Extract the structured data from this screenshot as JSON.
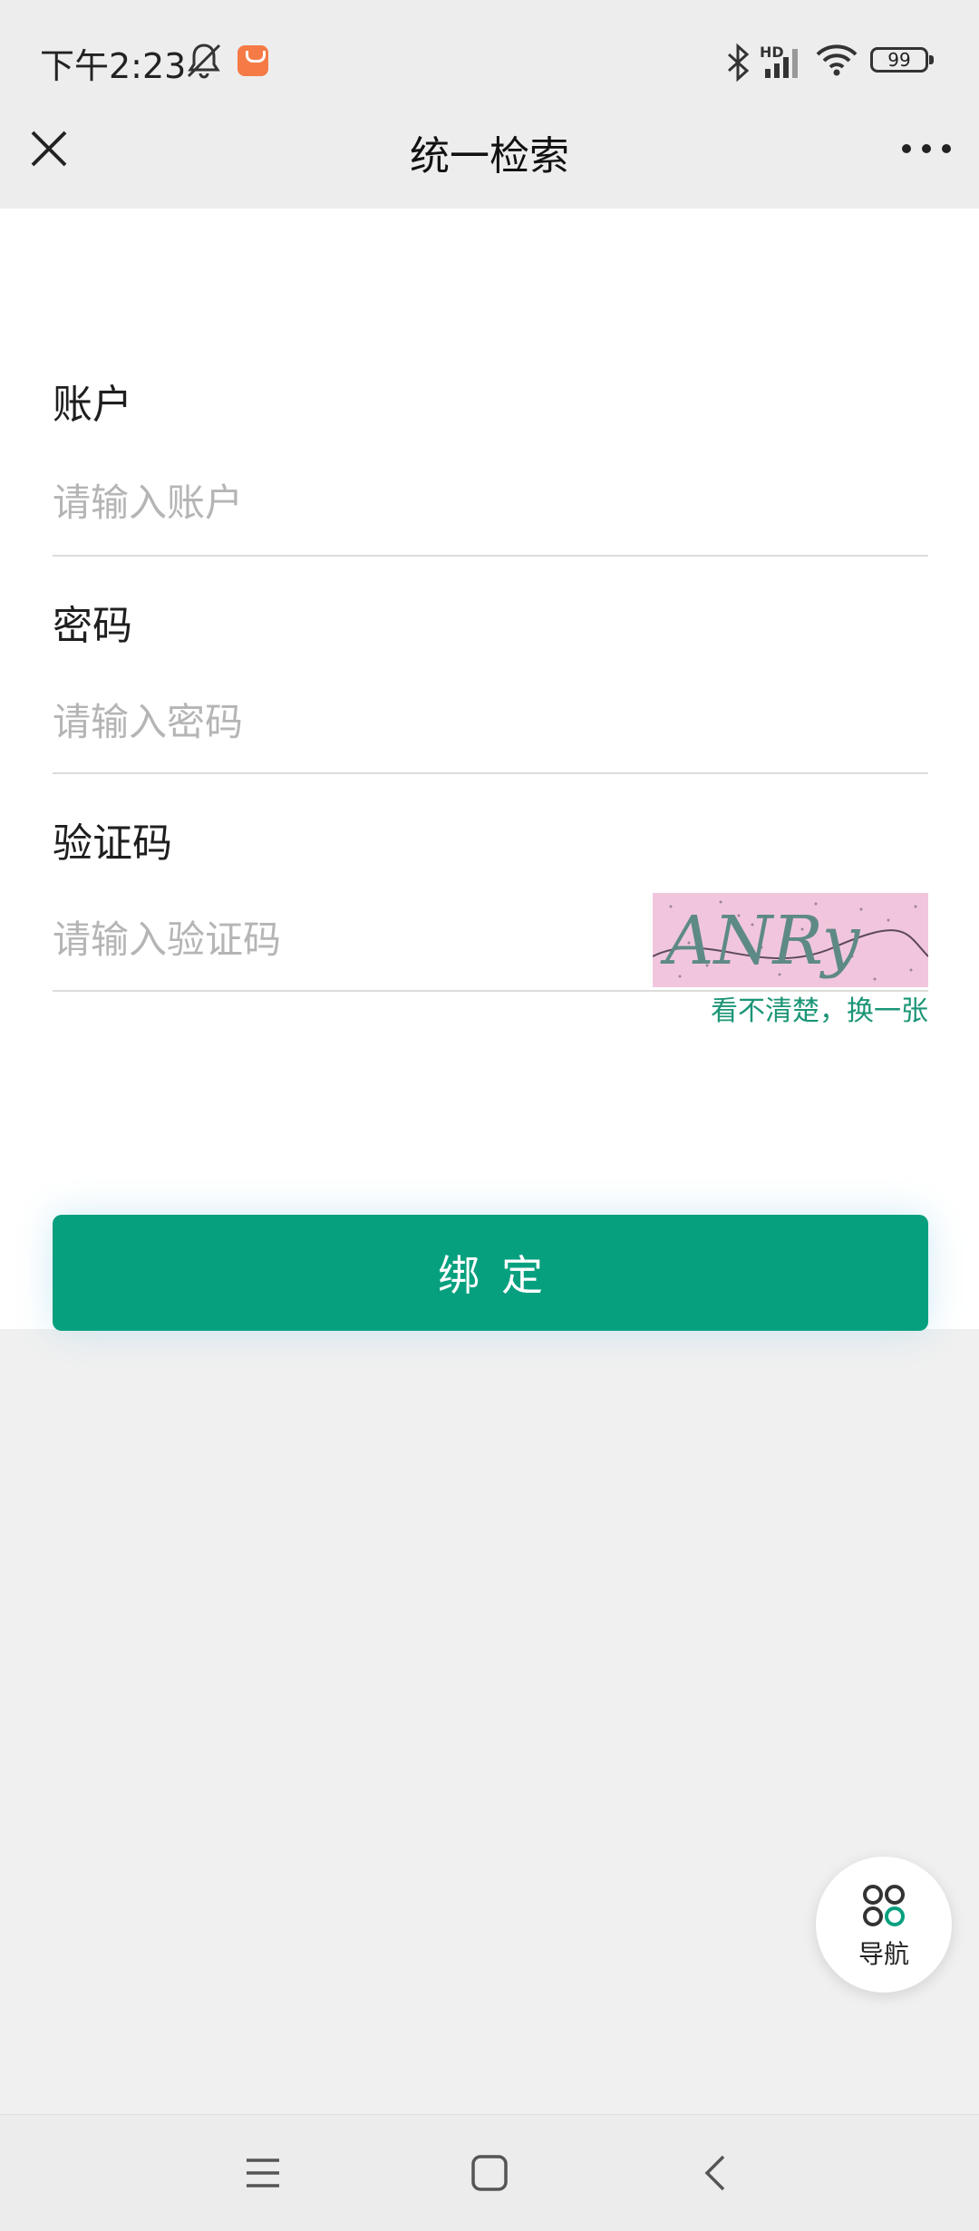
{
  "status_bar": {
    "time": "下午2:23",
    "network": "HD",
    "battery": "99"
  },
  "header": {
    "title": "统一检索",
    "close_icon": "close-icon",
    "more_icon": "more-icon"
  },
  "form": {
    "account": {
      "label": "账户",
      "placeholder": "请输入账户",
      "value": ""
    },
    "password": {
      "label": "密码",
      "placeholder": "请输入密码",
      "value": ""
    },
    "captcha": {
      "label": "验证码",
      "placeholder": "请输入验证码",
      "value": "",
      "image_text": "ANRy",
      "refresh_link": "看不清楚，换一张"
    },
    "submit_label": "绑定"
  },
  "floating_nav": {
    "label": "导航",
    "icon": "grid-icon"
  },
  "colors": {
    "accent": "#07a07f",
    "link": "#1b9576",
    "captcha_bg": "#f1c6dc"
  }
}
